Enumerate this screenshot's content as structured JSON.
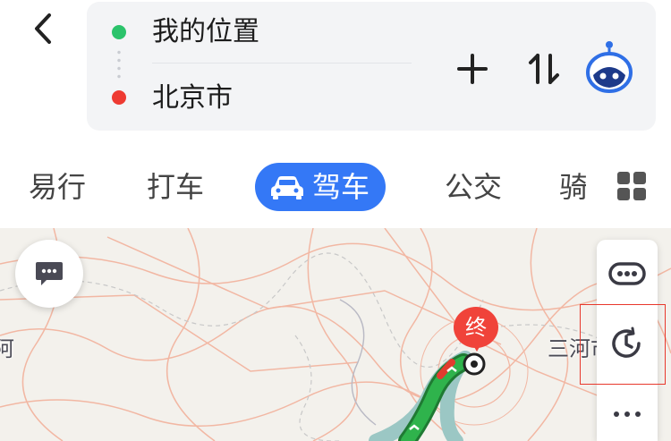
{
  "header": {
    "start_location": "我的位置",
    "end_location": "北京市"
  },
  "transport_tabs": [
    {
      "label": "易行"
    },
    {
      "label": "打车"
    },
    {
      "label": "驾车",
      "selected": true
    },
    {
      "label": "公交"
    },
    {
      "label": "骑"
    }
  ],
  "map": {
    "end_marker_label": "终",
    "place_labels": [
      "三河市",
      "阿"
    ]
  },
  "icons": {
    "back": "chevron-left-icon",
    "add": "plus-icon",
    "swap": "swap-vertical-icon",
    "assistant": "robot-assistant-icon",
    "grid": "grid-icon",
    "chat": "chat-bubble-icon",
    "traffic": "traffic-capsule-icon",
    "history": "clock-history-icon",
    "more": "more-dots-icon"
  },
  "colors": {
    "accent": "#3478f6",
    "start_dot": "#2bc36b",
    "end_dot": "#ee3a32",
    "route_green": "#29a846",
    "route_alt": "#9bc7c4",
    "marker_red": "#f0433a"
  }
}
